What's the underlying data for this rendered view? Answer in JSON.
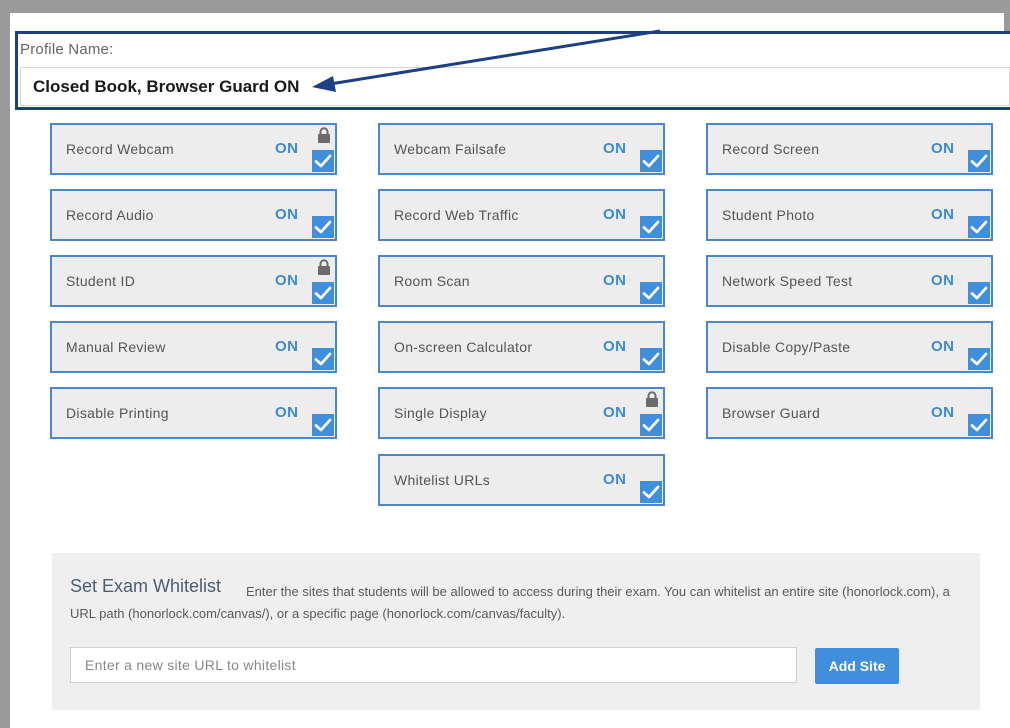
{
  "profile": {
    "label": "Profile Name:",
    "value": "Closed Book, Browser Guard ON"
  },
  "settings": [
    {
      "label": "Record Webcam",
      "state": "ON",
      "checked": true,
      "locked": true,
      "icon": "checkbox-checked-icon"
    },
    {
      "label": "Webcam Failsafe",
      "state": "ON",
      "checked": true,
      "locked": false,
      "icon": "checkbox-checked-icon"
    },
    {
      "label": "Record Screen",
      "state": "ON",
      "checked": true,
      "locked": false,
      "icon": "checkbox-checked-icon"
    },
    {
      "label": "Record Audio",
      "state": "ON",
      "checked": true,
      "locked": false,
      "icon": "checkbox-checked-icon"
    },
    {
      "label": "Record Web Traffic",
      "state": "ON",
      "checked": true,
      "locked": false,
      "icon": "checkbox-checked-icon"
    },
    {
      "label": "Student Photo",
      "state": "ON",
      "checked": true,
      "locked": false,
      "icon": "checkbox-checked-icon"
    },
    {
      "label": "Student ID",
      "state": "ON",
      "checked": true,
      "locked": true,
      "icon": "checkbox-checked-icon"
    },
    {
      "label": "Room Scan",
      "state": "ON",
      "checked": true,
      "locked": false,
      "icon": "checkbox-checked-icon"
    },
    {
      "label": "Network Speed Test",
      "state": "ON",
      "checked": true,
      "locked": false,
      "icon": "checkbox-checked-icon"
    },
    {
      "label": "Manual Review",
      "state": "ON",
      "checked": true,
      "locked": false,
      "icon": "checkbox-checked-icon"
    },
    {
      "label": "On-screen Calculator",
      "state": "ON",
      "checked": true,
      "locked": false,
      "icon": "checkbox-checked-icon"
    },
    {
      "label": "Disable Copy/Paste",
      "state": "ON",
      "checked": true,
      "locked": false,
      "icon": "checkbox-checked-icon"
    },
    {
      "label": "Disable Printing",
      "state": "ON",
      "checked": true,
      "locked": false,
      "icon": "checkbox-checked-icon"
    },
    {
      "label": "Single Display",
      "state": "ON",
      "checked": true,
      "locked": true,
      "icon": "checkbox-checked-icon"
    },
    {
      "label": "Browser Guard",
      "state": "ON",
      "checked": true,
      "locked": false,
      "icon": "checkbox-checked-icon"
    },
    {
      "label": "Whitelist URLs",
      "state": "ON",
      "checked": true,
      "locked": false,
      "icon": "checkbox-checked-icon"
    }
  ],
  "whitelist": {
    "title": "Set Exam Whitelist",
    "description": "Enter the sites that students will be allowed to access during their exam. You can whitelist an entire site (honorlock.com), a URL path (honorlock.com/canvas/), or a specific page (honorlock.com/canvas/faculty).",
    "input_placeholder": "Enter a new site URL to whitelist",
    "input_value": "",
    "add_button_label": "Add Site"
  },
  "colors": {
    "accent": "#3f8fdc",
    "tile_border": "#4a89c9",
    "annotation": "#1c3f86",
    "on_text": "#3b8bd6"
  }
}
